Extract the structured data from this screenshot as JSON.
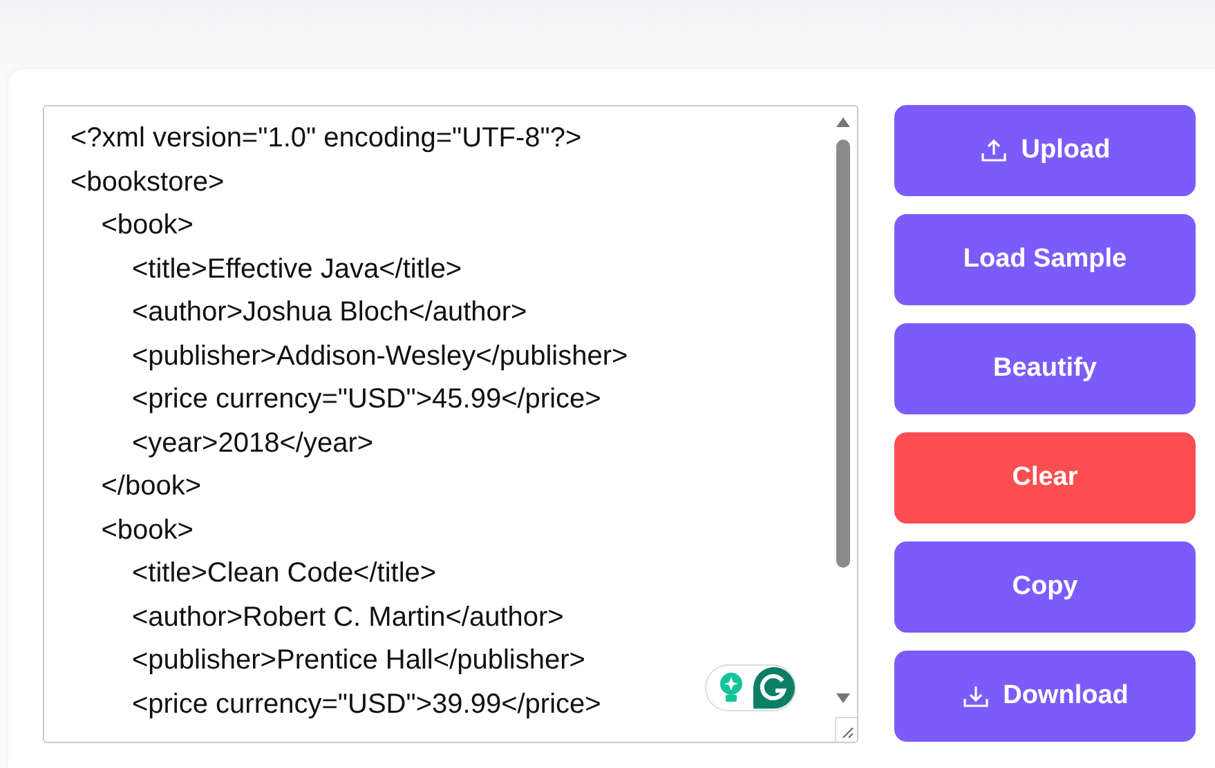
{
  "editor": {
    "value": "<?xml version=\"1.0\" encoding=\"UTF-8\"?>\n<bookstore>\n    <book>\n        <title>Effective Java</title>\n        <author>Joshua Bloch</author>\n        <publisher>Addison-Wesley</publisher>\n        <price currency=\"USD\">45.99</price>\n        <year>2018</year>\n    </book>\n    <book>\n        <title>Clean Code</title>\n        <author>Robert C. Martin</author>\n        <publisher>Prentice Hall</publisher>\n        <price currency=\"USD\">39.99</price>"
  },
  "buttons": [
    {
      "label": "Upload",
      "kind": "upload"
    },
    {
      "label": "Load Sample",
      "kind": "primary"
    },
    {
      "label": "Beautify",
      "kind": "primary"
    },
    {
      "label": "Clear",
      "kind": "danger"
    },
    {
      "label": "Copy",
      "kind": "primary"
    },
    {
      "label": "Download",
      "kind": "download"
    }
  ]
}
